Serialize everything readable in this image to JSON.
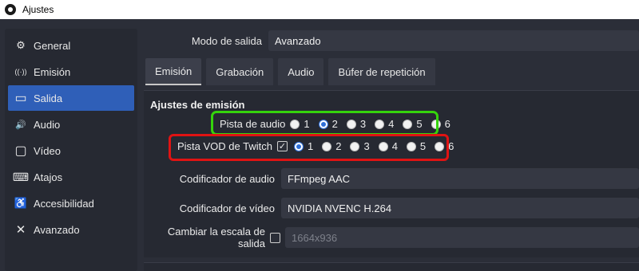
{
  "window": {
    "title": "Ajustes"
  },
  "sidebar": {
    "items": [
      {
        "label": "General",
        "icon": "gear-icon",
        "glyph": "⚙",
        "active": false
      },
      {
        "label": "Emisión",
        "icon": "broadcast-icon",
        "glyph": "((·))",
        "active": false
      },
      {
        "label": "Salida",
        "icon": "output-monitor-icon",
        "glyph": "▭",
        "active": true
      },
      {
        "label": "Audio",
        "icon": "speaker-icon",
        "glyph": "🔊",
        "active": false
      },
      {
        "label": "Vídeo",
        "icon": "display-icon",
        "glyph": "▢",
        "active": false
      },
      {
        "label": "Atajos",
        "icon": "keyboard-icon",
        "glyph": "⌨",
        "active": false
      },
      {
        "label": "Accesibilidad",
        "icon": "accessibility-icon",
        "glyph": "♿",
        "active": false
      },
      {
        "label": "Avanzado",
        "icon": "wrench-icon",
        "glyph": "✕",
        "active": false
      }
    ]
  },
  "output_mode": {
    "label": "Modo de salida",
    "value": "Avanzado"
  },
  "tabs": [
    {
      "label": "Emisión",
      "active": true
    },
    {
      "label": "Grabación",
      "active": false
    },
    {
      "label": "Audio",
      "active": false
    },
    {
      "label": "Búfer de repetición",
      "active": false
    }
  ],
  "section": {
    "title": "Ajustes de emisión"
  },
  "audio_track": {
    "label": "Pista de audio",
    "options": [
      "1",
      "2",
      "3",
      "4",
      "5",
      "6"
    ],
    "selected": "2"
  },
  "vod_track": {
    "label": "Pista VOD de Twitch",
    "enabled": true,
    "check_glyph": "✓",
    "options": [
      "1",
      "2",
      "3",
      "4",
      "5",
      "6"
    ],
    "selected": "1"
  },
  "audio_encoder": {
    "label": "Codificador de audio",
    "value": "FFmpeg AAC"
  },
  "video_encoder": {
    "label": "Codificador de vídeo",
    "value": "NVIDIA NVENC H.264"
  },
  "rescale": {
    "label": "Cambiar la escala de salida",
    "checked": false,
    "value": "1664x936"
  },
  "colors": {
    "accent": "#2f5fb8",
    "highlight_green": "#35d30c",
    "highlight_red": "#e01313"
  }
}
